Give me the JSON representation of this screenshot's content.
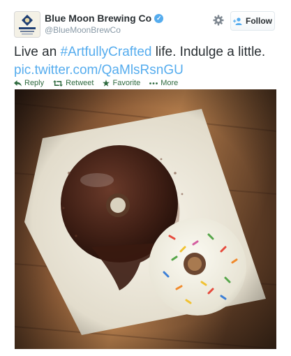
{
  "tweet": {
    "display_name": "Blue Moon Brewing Co",
    "screen_name": "@BlueMoonBrewCo",
    "verified_badge": "✓",
    "follow_label": "Follow",
    "text_before": "Live an ",
    "hashtag": "#ArtfullyCrafted",
    "text_after": " life. Indulge a little.",
    "link": "pic.twitter.com/QaMlsRsnGU"
  },
  "actions": [
    {
      "label": "Reply",
      "icon": "reply-icon"
    },
    {
      "label": "Retweet",
      "icon": "retweet-icon"
    },
    {
      "label": "Favorite",
      "icon": "star-icon"
    },
    {
      "label": "More",
      "icon": "ellipsis-icon"
    }
  ],
  "icons": {
    "settings": "gear-icon",
    "follow": "person-add-icon",
    "logo": "blue-moon-logo"
  },
  "colors": {
    "link": "#55acee",
    "action": "#2f6a3f",
    "name": "#292f33",
    "muted": "#8899a6"
  }
}
